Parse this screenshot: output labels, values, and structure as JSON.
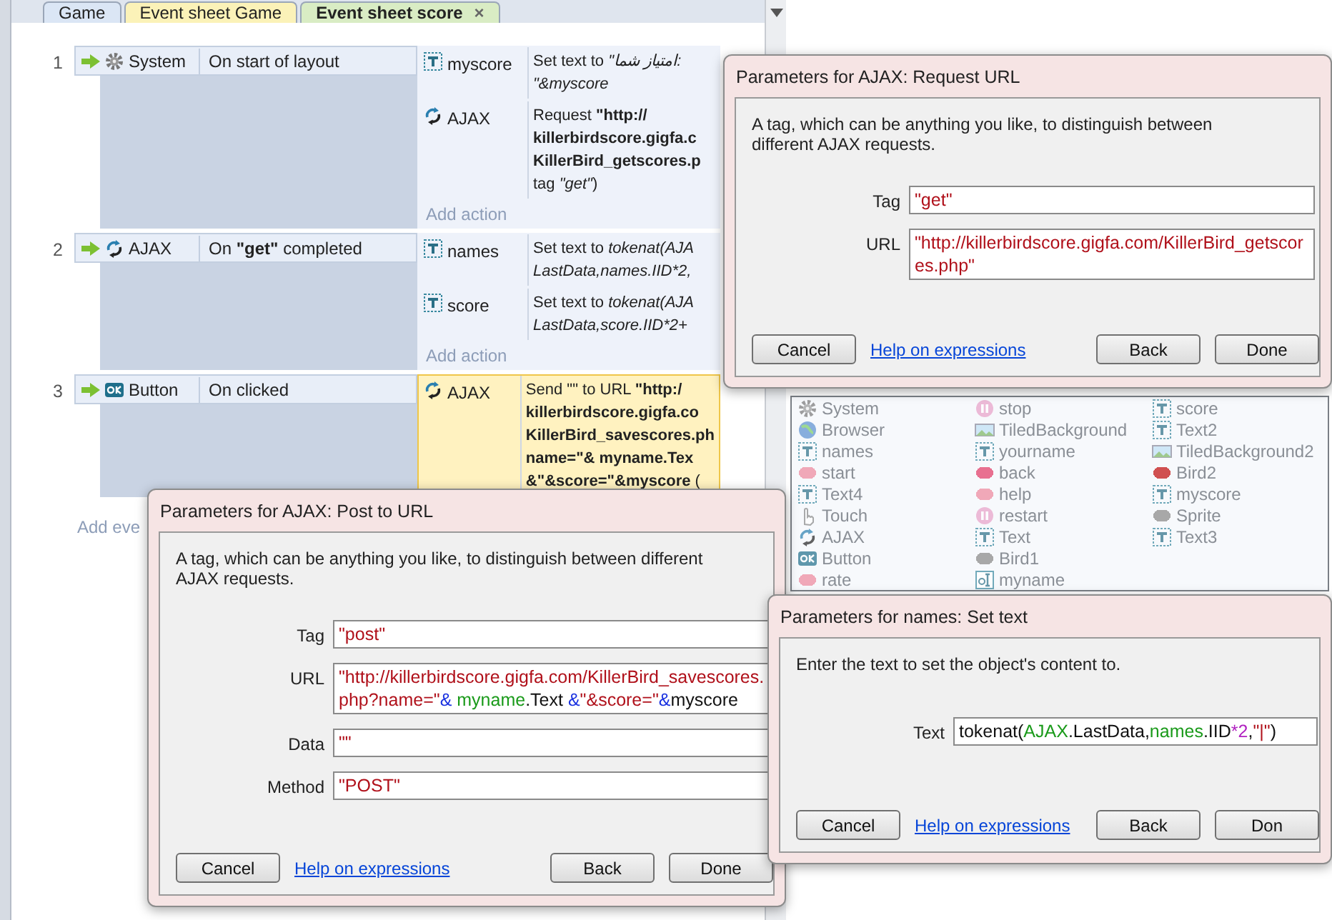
{
  "tabs": [
    {
      "label": "Game",
      "selected": false,
      "color": "#dbe6f5"
    },
    {
      "label": "Event sheet Game",
      "selected": false,
      "color": "#fbf2b8"
    },
    {
      "label": "Event sheet score",
      "selected": true,
      "color": "#d9ecc4",
      "close": "×"
    }
  ],
  "object_picker": {
    "items": [
      {
        "name": "System",
        "kind": "system"
      },
      {
        "name": "Browser",
        "kind": "browser"
      },
      {
        "name": "names",
        "kind": "text"
      },
      {
        "name": "start",
        "kind": "sprite",
        "color": "#f0a8b8"
      },
      {
        "name": "Text4",
        "kind": "text"
      },
      {
        "name": "Touch",
        "kind": "touch"
      },
      {
        "name": "AJAX",
        "kind": "ajax"
      },
      {
        "name": "Button",
        "kind": "button"
      },
      {
        "name": "rate",
        "kind": "sprite",
        "color": "#f0a8b8"
      },
      {
        "name": "stop",
        "kind": "pause"
      },
      {
        "name": "TiledBackground",
        "kind": "tiledbg"
      },
      {
        "name": "yourname",
        "kind": "text"
      },
      {
        "name": "back",
        "kind": "sprite",
        "color": "#e87090"
      },
      {
        "name": "help",
        "kind": "sprite",
        "color": "#f0a8b8"
      },
      {
        "name": "restart",
        "kind": "pause"
      },
      {
        "name": "Text",
        "kind": "text"
      },
      {
        "name": "Bird1",
        "kind": "sprite",
        "color": "#a8a8a8"
      },
      {
        "name": "myname",
        "kind": "textbox"
      },
      {
        "name": "score",
        "kind": "text"
      },
      {
        "name": "Text2",
        "kind": "text"
      },
      {
        "name": "TiledBackground2",
        "kind": "tiledbg"
      },
      {
        "name": "Bird2",
        "kind": "sprite",
        "color": "#d05050"
      },
      {
        "name": "myscore",
        "kind": "text"
      },
      {
        "name": "Sprite",
        "kind": "sprite",
        "color": "#a8a8a8"
      },
      {
        "name": "Text3",
        "kind": "text"
      }
    ]
  },
  "events": [
    {
      "number": "1",
      "condition": {
        "object": "System",
        "kind": "system",
        "text": [
          {
            "text": "On start of layout",
            "kind": "plain"
          }
        ]
      },
      "actions": [
        {
          "object": "myscore",
          "kind": "text",
          "selected": false,
          "lines": [
            [
              {
                "text": "Set text to ",
                "kind": "plain"
              },
              {
                "text": "\"امتیاز شما:",
                "kind": "expression"
              }
            ],
            [
              {
                "text": "\"&myscore",
                "kind": "expression"
              }
            ]
          ]
        },
        {
          "object": "AJAX",
          "kind": "ajax",
          "selected": false,
          "lines": [
            [
              {
                "text": "Request ",
                "kind": "plain"
              },
              {
                "text": "\"http://",
                "kind": "literal"
              }
            ],
            [
              {
                "text": "killerbirdscore.gigfa.c",
                "kind": "literal"
              }
            ],
            [
              {
                "text": "KillerBird_getscores.p",
                "kind": "literal"
              }
            ],
            [
              {
                "text": "tag ",
                "kind": "plain"
              },
              {
                "text": "\"get\"",
                "kind": "expression"
              },
              {
                "text": ")",
                "kind": "plain"
              }
            ]
          ]
        }
      ],
      "add_action": "Add action"
    },
    {
      "number": "2",
      "condition": {
        "object": "AJAX",
        "kind": "ajax",
        "text": [
          {
            "text": "On ",
            "kind": "plain"
          },
          {
            "text": "\"get\"",
            "kind": "literal"
          },
          {
            "text": " completed",
            "kind": "plain"
          }
        ]
      },
      "actions": [
        {
          "object": "names",
          "kind": "text",
          "selected": false,
          "lines": [
            [
              {
                "text": "Set text to ",
                "kind": "plain"
              },
              {
                "text": "tokenat(AJA",
                "kind": "expression"
              }
            ],
            [
              {
                "text": "LastData,names.IID*2,",
                "kind": "expression"
              }
            ]
          ]
        },
        {
          "object": "score",
          "kind": "text",
          "selected": false,
          "lines": [
            [
              {
                "text": "Set text to ",
                "kind": "plain"
              },
              {
                "text": "tokenat(AJA",
                "kind": "expression"
              }
            ],
            [
              {
                "text": "LastData,score.IID*2+",
                "kind": "expression"
              }
            ]
          ]
        }
      ],
      "add_action": "Add action"
    },
    {
      "number": "3",
      "condition": {
        "object": "Button",
        "kind": "button",
        "text": [
          {
            "text": "On clicked",
            "kind": "plain"
          }
        ]
      },
      "actions": [
        {
          "object": "AJAX",
          "kind": "ajax",
          "selected": true,
          "lines": [
            [
              {
                "text": "Send \"\" to URL ",
                "kind": "plain"
              },
              {
                "text": "\"http:/",
                "kind": "literal"
              }
            ],
            [
              {
                "text": "killerbirdscore.gigfa.co",
                "kind": "literal"
              }
            ],
            [
              {
                "text": "KillerBird_savescores.ph",
                "kind": "literal"
              }
            ],
            [
              {
                "text": "name=\"& myname.Tex",
                "kind": "literal"
              }
            ],
            [
              {
                "text": "&\"&score=\"&myscore",
                "kind": "literal"
              },
              {
                "text": " (",
                "kind": "plain"
              }
            ]
          ]
        }
      ]
    }
  ],
  "add_event": "Add eve",
  "dialogs": [
    {
      "title": "Parameters for AJAX: Request URL",
      "description": "A tag, which can be anything you like, to distinguish between different AJAX requests.",
      "fields": [
        {
          "label": "Tag",
          "value": [
            {
              "text": "\"get\"",
              "kind": "string"
            }
          ]
        },
        {
          "label": "URL",
          "value": [
            {
              "text": "\"http://killerbirdscore.gigfa.com/KillerBird_getscores.php\"",
              "kind": "string"
            }
          ]
        }
      ],
      "buttons": [
        {
          "label": "Cancel",
          "kind": "button"
        },
        {
          "label": "Help on expressions",
          "kind": "link"
        },
        {
          "label": "Back",
          "kind": "button"
        },
        {
          "label": "Done",
          "kind": "button"
        }
      ]
    },
    {
      "title": "Parameters for AJAX: Post to URL",
      "description": "A tag, which can be anything you like, to distinguish between different AJAX requests.",
      "fields": [
        {
          "label": "Tag",
          "value": [
            {
              "text": "\"post\"",
              "kind": "string"
            }
          ]
        },
        {
          "label": "URL",
          "value": [
            {
              "text": "\"http://killerbirdscore.gigfa.com/KillerBird_savescores.php?name=\"",
              "kind": "string"
            },
            {
              "text": "& ",
              "kind": "operator"
            },
            {
              "text": "myname",
              "kind": "object"
            },
            {
              "text": ".Text ",
              "kind": "plain"
            },
            {
              "text": "&",
              "kind": "operator"
            },
            {
              "text": "\"&score=\"",
              "kind": "string"
            },
            {
              "text": "&",
              "kind": "operator"
            },
            {
              "text": "myscore",
              "kind": "plain"
            }
          ]
        },
        {
          "label": "Data",
          "value": [
            {
              "text": "\"\"",
              "kind": "string"
            }
          ]
        },
        {
          "label": "Method",
          "value": [
            {
              "text": "\"POST\"",
              "kind": "string"
            }
          ]
        }
      ],
      "buttons": [
        {
          "label": "Cancel",
          "kind": "button"
        },
        {
          "label": "Help on expressions",
          "kind": "link"
        },
        {
          "label": "Back",
          "kind": "button"
        },
        {
          "label": "Done",
          "kind": "button"
        }
      ]
    },
    {
      "title": "Parameters for names: Set text",
      "description": "Enter the text to set the object's content to.",
      "fields": [
        {
          "label": "Text",
          "value": [
            {
              "text": "tokenat(",
              "kind": "plain"
            },
            {
              "text": "AJAX",
              "kind": "object"
            },
            {
              "text": ".LastData,",
              "kind": "plain"
            },
            {
              "text": "names",
              "kind": "object"
            },
            {
              "text": ".IID",
              "kind": "plain"
            },
            {
              "text": "*2",
              "kind": "number"
            },
            {
              "text": ",",
              "kind": "plain"
            },
            {
              "text": "\"|\"",
              "kind": "string"
            },
            {
              "text": ")",
              "kind": "plain"
            }
          ]
        }
      ],
      "buttons": [
        {
          "label": "Cancel",
          "kind": "button"
        },
        {
          "label": "Help on expressions",
          "kind": "link"
        },
        {
          "label": "Back",
          "kind": "button"
        },
        {
          "label": "Don",
          "kind": "button"
        }
      ]
    }
  ]
}
